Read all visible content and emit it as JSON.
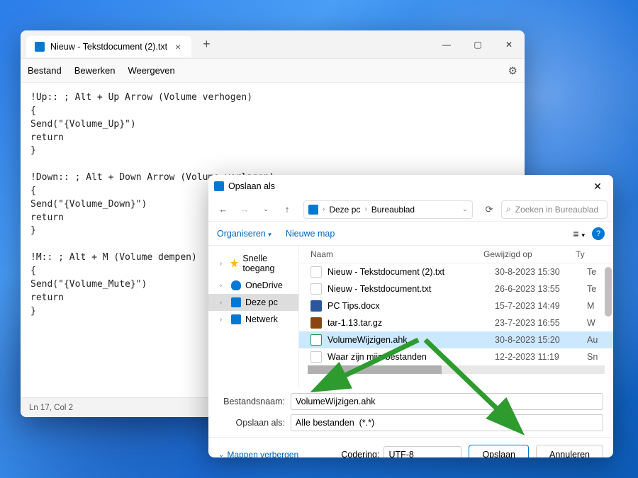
{
  "notepad": {
    "tab_title": "Nieuw - Tekstdocument (2).txt",
    "menu": {
      "file": "Bestand",
      "edit": "Bewerken",
      "view": "Weergeven"
    },
    "content": "!Up:: ; Alt + Up Arrow (Volume verhogen)\n{\nSend(\"{Volume_Up}\")\nreturn\n}\n\n!Down:: ; Alt + Down Arrow (Volume verlagen)\n{\nSend(\"{Volume_Down}\")\nreturn\n}\n\n!M:: ; Alt + M (Volume dempen)\n{\nSend(\"{Volume_Mute}\")\nreturn\n}",
    "status": "Ln 17, Col 2"
  },
  "dialog": {
    "title": "Opslaan als",
    "breadcrumb": {
      "root": "Deze pc",
      "folder": "Bureaublad"
    },
    "search_placeholder": "Zoeken in Bureaublad",
    "toolbar": {
      "organize": "Organiseren",
      "new_folder": "Nieuwe map"
    },
    "tree": [
      {
        "label": "Snelle toegang",
        "icon": "star"
      },
      {
        "label": "OneDrive",
        "icon": "cloud"
      },
      {
        "label": "Deze pc",
        "icon": "pc",
        "selected": true
      },
      {
        "label": "Netwerk",
        "icon": "net"
      }
    ],
    "columns": {
      "name": "Naam",
      "modified": "Gewijzigd op",
      "type": "Ty"
    },
    "files": [
      {
        "name": "Nieuw - Tekstdocument (2).txt",
        "date": "30-8-2023 15:30",
        "type": "Te",
        "icon": "txt"
      },
      {
        "name": "Nieuw - Tekstdocument.txt",
        "date": "26-6-2023 13:55",
        "type": "Te",
        "icon": "txt"
      },
      {
        "name": "PC Tips.docx",
        "date": "15-7-2023 14:49",
        "type": "M",
        "icon": "docx"
      },
      {
        "name": "tar-1.13.tar.gz",
        "date": "23-7-2023 16:55",
        "type": "W",
        "icon": "tar"
      },
      {
        "name": "VolumeWijzigen.ahk",
        "date": "30-8-2023 15:20",
        "type": "Au",
        "icon": "ahk",
        "selected": true
      },
      {
        "name": "Waar zijn mijn bestanden",
        "date": "12-2-2023 11:19",
        "type": "Sn",
        "icon": "txt"
      }
    ],
    "labels": {
      "filename": "Bestandsnaam:",
      "saveas": "Opslaan als:",
      "encoding": "Codering:",
      "hide": "Mappen verbergen"
    },
    "filename_value": "VolumeWijzigen.ahk",
    "filter_value": "Alle bestanden  (*.*)",
    "encoding_value": "UTF-8",
    "buttons": {
      "save": "Opslaan",
      "cancel": "Annuleren"
    }
  }
}
